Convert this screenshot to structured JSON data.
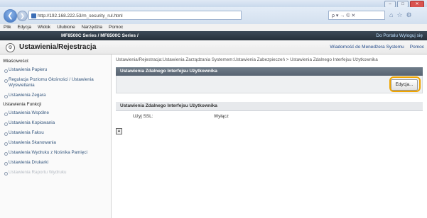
{
  "browser": {
    "url": "http://192.168.222.53/m_security_rul.html",
    "search_placeholder": "ρ ▾ → © ✕",
    "window_buttons": [
      "‒",
      "□",
      "✕"
    ],
    "toolbar_icons": [
      "⌂",
      "☆",
      "⚙"
    ]
  },
  "menubar": {
    "items": [
      "Plik",
      "Edycja",
      "Widok",
      "Ulubione",
      "Narzędzia",
      "Pomoc"
    ]
  },
  "linkbar": {
    "title": "MF8500C Series / MF8500C Series /",
    "right": "Do Portalu  Wyloguj się"
  },
  "app": {
    "title": "Ustawienia/Rejestracja",
    "icon_glyph": "⚙",
    "header_right_1": "Wiadomość do Menedżera Systemu",
    "header_right_2": "Pomoc"
  },
  "sidebar": {
    "group1": "Właściwości:",
    "items1": [
      "Ustawienia Papieru",
      "Regulacja Poziomu Głośności / Ustawienia Wyświetlania",
      "Ustawienia Zegara"
    ],
    "group2": "Ustawienia Funkcji",
    "items2": [
      "Ustawienia Wspólne",
      "Ustawienia Kopiowania",
      "Ustawienia Faksu",
      "Ustawienia Skanowania",
      "Ustawienia Wydruku z Nośnika Pamięci",
      "Ustawienia Drukarki",
      "Ustawienia Raportu Wydruku"
    ]
  },
  "main": {
    "breadcrumb": "Ustawienia/Rejestracja:Ustawienia Zarządzania Systemem:Ustawienia Zabezpieczeń > Ustawienia Zdalnego Interfejsu Użytkownika",
    "section_title": "Ustawienia Zdalnego Interfejsu Użytkownika",
    "edit_button": "Edycja...",
    "settings_header": "Ustawienia Zdalnego Interfejsu Użytkownika",
    "row_label": "Użyj SSL:",
    "row_value": "Wyłącz",
    "top_icon": "▲"
  }
}
